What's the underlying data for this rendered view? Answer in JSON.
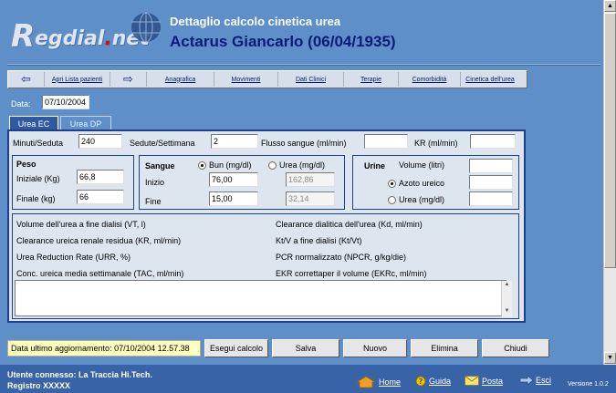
{
  "app": {
    "logo_text_r": "R",
    "logo_text_rest": "egdial",
    "logo_dot": ".",
    "logo_net": "net",
    "header_title": "Dettaglio calcolo cinetica urea",
    "patient": "Actarus Giancarlo (06/04/1935)"
  },
  "nav": {
    "items": [
      "Apri Lista pazienti",
      "Anagrafica",
      "Movimenti",
      "Dati Clinici",
      "Terapie",
      "Comorbidità",
      "Cinetica dell'urea"
    ],
    "back_icon": "arrow-left-icon",
    "forward_icon": "arrow-right-icon"
  },
  "date": {
    "label": "Data:",
    "value": "07/10/2004"
  },
  "tabs": [
    "Urea EC",
    "Urea DP"
  ],
  "form": {
    "minuti_label": "Minuti/Seduta",
    "minuti_value": "240",
    "sedute_label": "Sedute/Settimana",
    "sedute_value": "2",
    "flusso_label": "Flusso sangue (ml/min)",
    "flusso_value": "",
    "kr_label": "KR (ml/min)",
    "kr_value": "",
    "peso": {
      "title": "Peso",
      "iniziale_label": "Iniziale (Kg)",
      "iniziale_value": "66,8",
      "finale_label": "Finale (kg)",
      "finale_value": "66"
    },
    "sangue": {
      "title": "Sangue",
      "bun_label": "Bun (mg/dl)",
      "urea_label": "Urea (mg/dl)",
      "inizio_label": "Inizio",
      "fine_label": "Fine",
      "bun_inizio": "76,00",
      "bun_fine": "15,00",
      "urea_inizio": "162,86",
      "urea_fine": "32,14"
    },
    "urine": {
      "title": "Urine",
      "volume_label": "Volume (litri)",
      "azoto_label": "Azoto ureico",
      "urea_label": "Urea (mg/dl)",
      "volume_value": "",
      "azoto_value": "",
      "urea_value": ""
    }
  },
  "results": {
    "left": [
      "Volume dell'urea a fine dialisi (VT, l)",
      "Clearance ureica renale residua (KR, ml/min)",
      "Urea Reduction Rate (URR, %)",
      "Conc. ureica media settimanale (TAC, ml/min)"
    ],
    "right": [
      "Clearance dialitica dell'urea (Kd, ml/min)",
      "Kt/V a fine dialisi (Kt/Vt)",
      "PCR normalizzato (NPCR, g/kg/die)",
      "EKR correttaper il volume (EKRc, ml/min)"
    ]
  },
  "notes": "",
  "bottom": {
    "last_update": "Data ultimo aggiornamento: 07/10/2004 12.57.38",
    "buttons": [
      "Esegui calcolo",
      "Salva",
      "Nuovo",
      "Elimina",
      "Chiudi"
    ]
  },
  "footer": {
    "user": "Utente connesso: La Traccia Hi.Tech.",
    "registry": "Registro XXXXX",
    "links": [
      "Home",
      "Guida",
      "Posta",
      "Esci"
    ],
    "version": "Versione 1.0.2"
  },
  "colors": {
    "background": "#5f8fc9",
    "panel": "#dde5ef",
    "accent": "#1d3f8c",
    "footer": "#3863a6",
    "status_bg": "#ffffbf"
  }
}
